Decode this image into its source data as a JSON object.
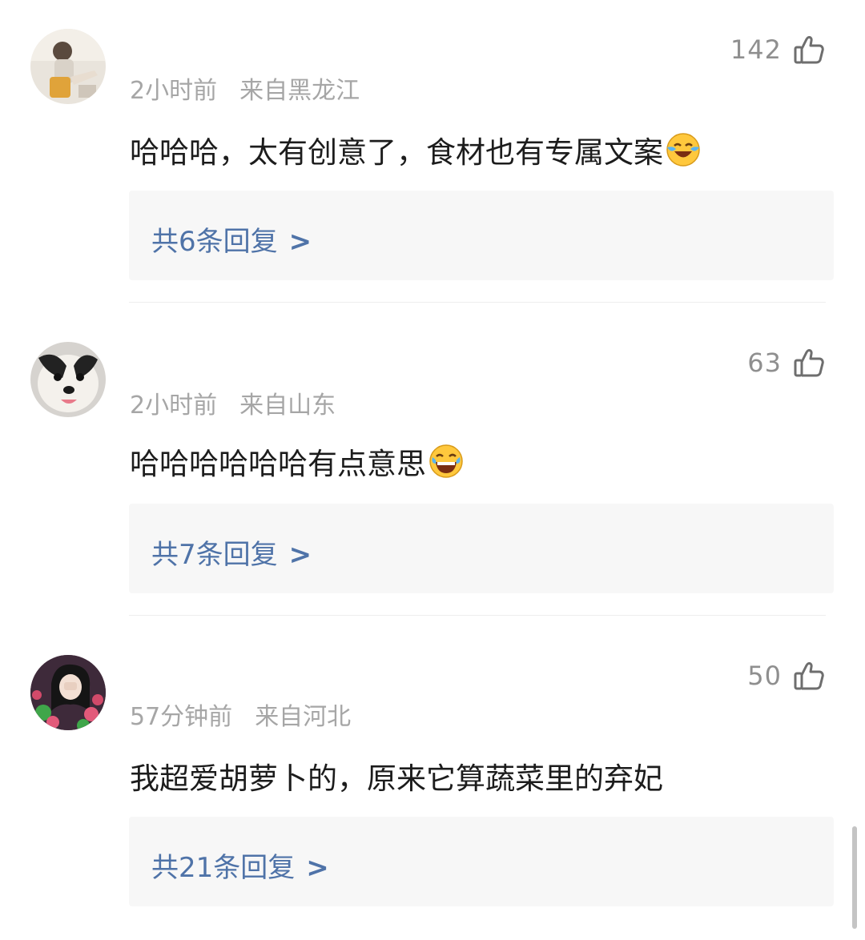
{
  "comments": [
    {
      "time": "2小时前",
      "location": "来自黑龙江",
      "text": "哈哈哈，太有创意了，食材也有专属文案",
      "emoji": "laughing-crying-emoji",
      "likes": "142",
      "reply_count_label": "共6条回复",
      "reply_arrow": ">"
    },
    {
      "time": "2小时前",
      "location": "来自山东",
      "text": "哈哈哈哈哈哈有点意思",
      "emoji": "tears-of-joy-emoji",
      "likes": "63",
      "reply_count_label": "共7条回复",
      "reply_arrow": ">"
    },
    {
      "time": "57分钟前",
      "location": "来自河北",
      "text": "我超爱胡萝卜的，原来它算蔬菜里的弃妃",
      "likes": "50",
      "reply_count_label": "共21条回复",
      "reply_arrow": ">"
    }
  ],
  "icons": {
    "like": "thumbs-up-outline-icon"
  },
  "colors": {
    "reply_link": "#4f73a8",
    "meta_text": "#a6a6a6",
    "reply_bg": "#f7f7f7"
  }
}
